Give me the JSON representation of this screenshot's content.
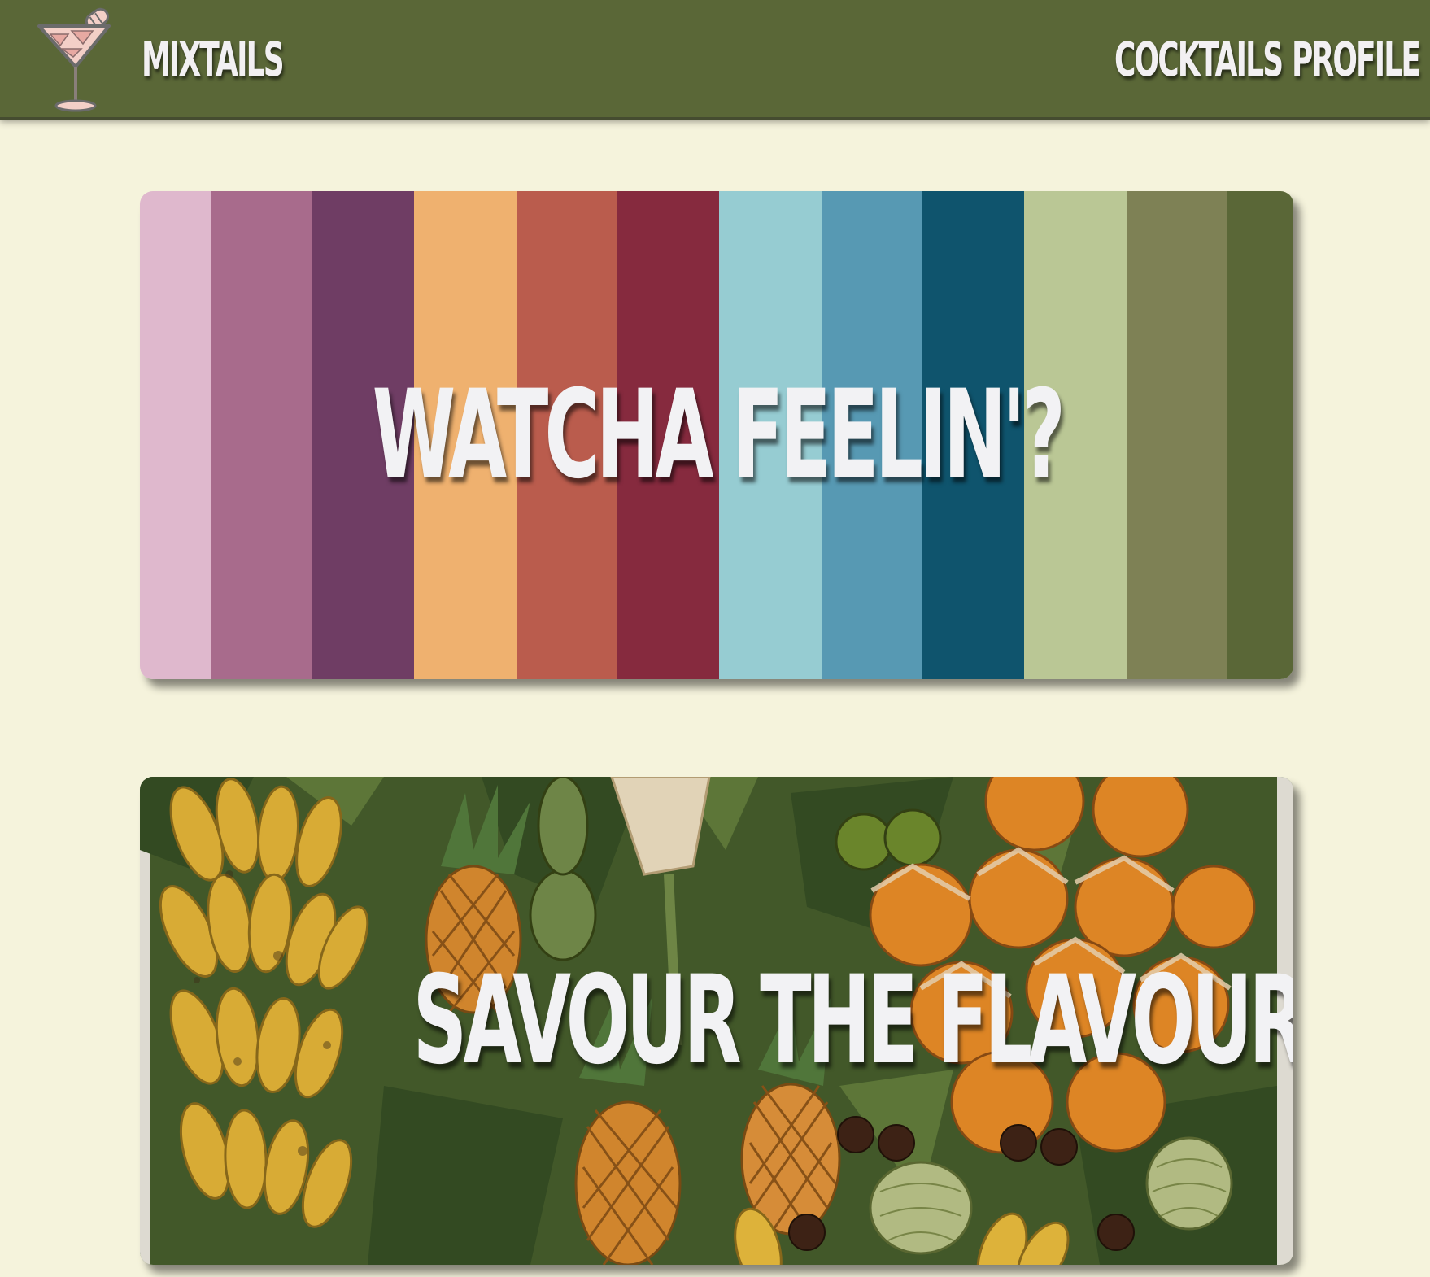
{
  "nav": {
    "logo_icon": "cocktail-glass-icon",
    "brand": "MIXTAILS",
    "links": [
      {
        "label": "COCKTAILS"
      },
      {
        "label": "PROFILE"
      }
    ],
    "background_color": "#5a6737",
    "text_color": "#f2f0f2"
  },
  "page": {
    "background_color": "#f5f3dc"
  },
  "mood_card": {
    "title": "WATCHA FEELIN'?",
    "stripe_colors": [
      "#dfb8cd",
      "#a86b8c",
      "#6f3d64",
      "#efb16f",
      "#ba5c4d",
      "#862a3e",
      "#96ccd2",
      "#5799b3",
      "#0f546d",
      "#bac795",
      "#7e8155",
      "#5a6737"
    ]
  },
  "flavour_card": {
    "title": "SAVOUR THE FLAVOUR",
    "image": "tropical-fruit-market-photo"
  }
}
